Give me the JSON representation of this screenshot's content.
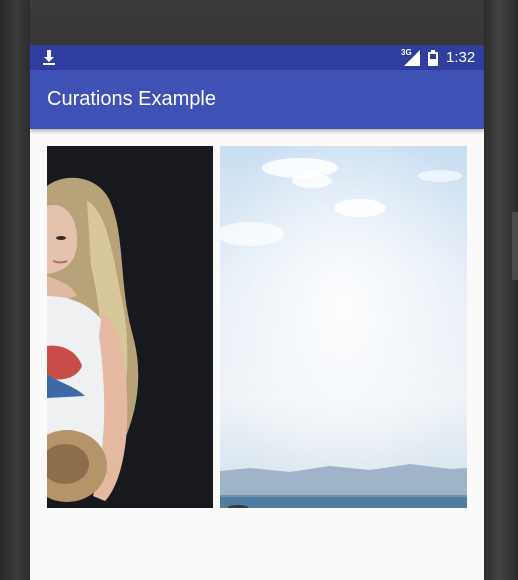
{
  "status_bar": {
    "time": "1:32",
    "network": "3G",
    "download_icon": "download-icon",
    "signal_icon": "signal-icon",
    "battery_icon": "battery-icon"
  },
  "app_bar": {
    "title": "Curations Example"
  },
  "colors": {
    "status_bar": "#303f9f",
    "app_bar": "#3f51b5",
    "screen_bg": "#fafafa"
  },
  "gallery": {
    "tiles": [
      {
        "name": "portrait-photo",
        "description": "photo"
      },
      {
        "name": "sky-sea-photo",
        "description": "photo"
      }
    ]
  }
}
